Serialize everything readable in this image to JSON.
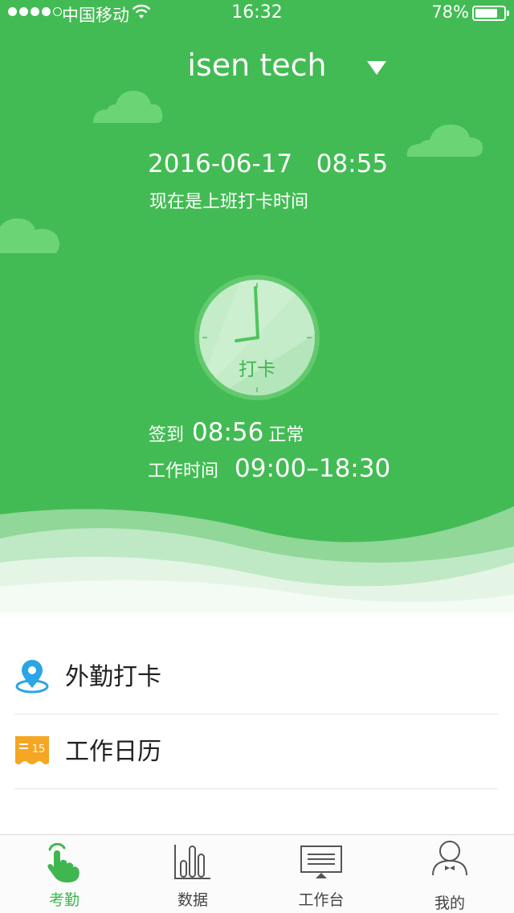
{
  "status_bar": {
    "carrier": "中国移动",
    "time": "16:32",
    "battery": "78%",
    "battery_level": 0.78,
    "signal_bars_filled": 4,
    "signal_bars_total": 5
  },
  "header": {
    "company": "isen tech",
    "dropdown_icon": "caret-down-icon"
  },
  "attendance": {
    "date": "2016-06-17",
    "time": "08:55",
    "prompt": "现在是上班打卡时间",
    "punch_button_label": "打卡",
    "checkin_label": "签到",
    "checkin_time": "08:56",
    "checkin_status": "正常",
    "work_hours_label": "工作时间",
    "work_hours": "09:00–18:30"
  },
  "menu": {
    "items": [
      {
        "label": "外勤打卡",
        "icon": "location-pin-icon"
      },
      {
        "label": "工作日历",
        "icon": "calendar-icon",
        "icon_text": "15"
      }
    ]
  },
  "tab_bar": {
    "tabs": [
      {
        "label": "考勤",
        "icon": "hand-tap-icon",
        "active": true
      },
      {
        "label": "数据",
        "icon": "bar-chart-icon",
        "active": false
      },
      {
        "label": "工作台",
        "icon": "monitor-icon",
        "active": false
      },
      {
        "label": "我的",
        "icon": "user-icon",
        "active": false
      }
    ]
  },
  "colors": {
    "primary_green": "#43bb54",
    "active_tab": "#3fb64f",
    "location_icon": "#2aa5e6",
    "calendar_icon": "#f5a623"
  }
}
